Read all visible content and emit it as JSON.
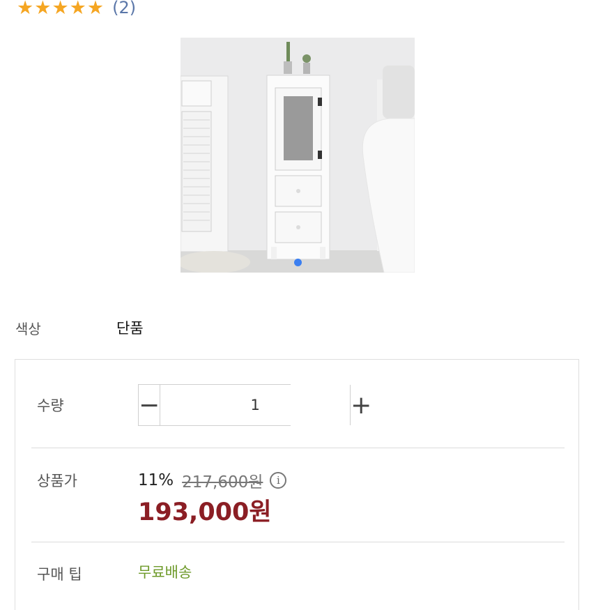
{
  "rating": {
    "stars": 5,
    "review_count": "(2)"
  },
  "carousel": {
    "active_index": 0
  },
  "color_option": {
    "label": "색상",
    "value": "단품"
  },
  "quantity": {
    "label": "수량",
    "minus": "−",
    "plus": "+",
    "value": "1"
  },
  "price": {
    "label": "상품가",
    "discount": "11%",
    "original": "217,600원",
    "info": "i",
    "sale": "193,000원"
  },
  "purchase_tip": {
    "label": "구매 팁",
    "value": "무료배송"
  },
  "colors": {
    "star": "#f5a623",
    "sale_price": "#8b1e24",
    "tip": "#6e9a2a",
    "dot": "#3b7ff0"
  }
}
